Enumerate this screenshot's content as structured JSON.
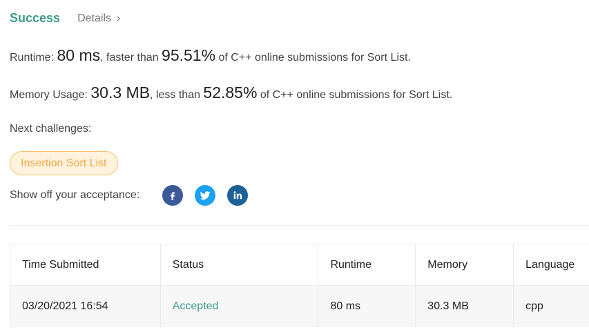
{
  "header": {
    "status": "Success",
    "details_label": "Details",
    "details_chevron": "›"
  },
  "runtime": {
    "label": "Runtime: ",
    "value": "80 ms",
    "mid_text": ", faster than ",
    "percent": "95.51%",
    "suffix": " of C++ online submissions for Sort List."
  },
  "memory": {
    "label": "Memory Usage: ",
    "value": "30.3 MB",
    "mid_text": ", less than ",
    "percent": "52.85%",
    "suffix": " of C++ online submissions for Sort List."
  },
  "next_challenges": {
    "label": "Next challenges:",
    "items": [
      "Insertion Sort List"
    ]
  },
  "share": {
    "label": "Show off your acceptance:",
    "icons": [
      "facebook-icon",
      "twitter-icon",
      "linkedin-icon"
    ]
  },
  "table": {
    "headers": [
      "Time Submitted",
      "Status",
      "Runtime",
      "Memory",
      "Language"
    ],
    "rows": [
      [
        "03/20/2021 16:54",
        "Accepted",
        "80 ms",
        "30.3 MB",
        "cpp"
      ]
    ]
  },
  "colors": {
    "success": "#3f9a8c",
    "tag_border": "#f5c06b",
    "tag_text": "#f0a845",
    "facebook": "#3b5998",
    "twitter": "#1da1f2",
    "linkedin": "#1b6296"
  }
}
